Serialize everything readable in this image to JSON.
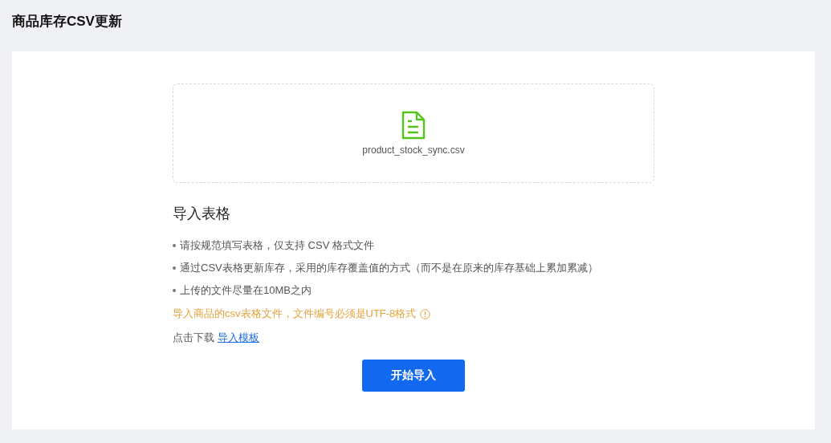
{
  "page_title": "商品库存CSV更新",
  "upload": {
    "filename": "product_stock_sync.csv"
  },
  "instructions": {
    "heading": "导入表格",
    "bullets": [
      "请按规范填写表格，仅支持 CSV 格式文件",
      "通过CSV表格更新库存，采用的库存覆盖值的方式（而不是在原来的库存基础上累加累减）",
      "上传的文件尽量在10MB之内"
    ],
    "warning": "导入商品的csv表格文件，文件编号必须是UTF-8格式",
    "download_prefix": "点击下载",
    "download_link": "导入模板"
  },
  "submit_button": "开始导入"
}
